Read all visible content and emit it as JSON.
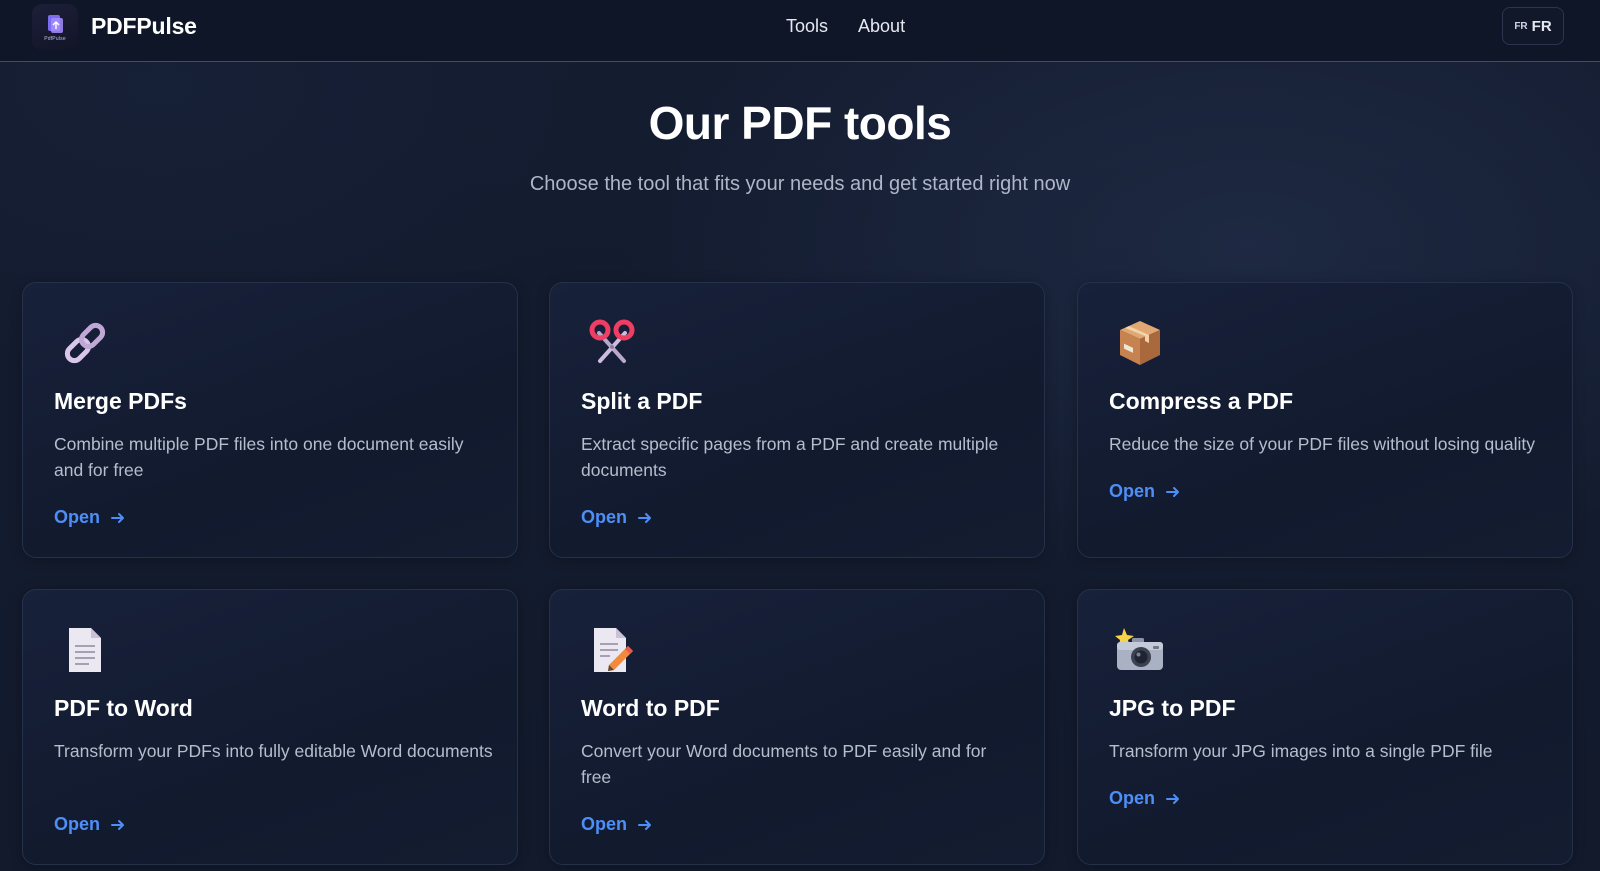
{
  "navbar": {
    "logo_text": "PdfPulse",
    "brand": "PDFPulse",
    "links": [
      "Tools",
      "About"
    ],
    "language": {
      "flag_label": "FR",
      "code": "FR"
    }
  },
  "hero": {
    "title": "Our PDF tools",
    "subtitle": "Choose the tool that fits your needs and get started right now"
  },
  "tools": [
    {
      "title": "Merge PDFs",
      "description": "Combine multiple PDF files into one document easily and for free",
      "action": "Open",
      "icon": "link-icon"
    },
    {
      "title": "Split a PDF",
      "description": "Extract specific pages from a PDF and create multiple documents",
      "action": "Open",
      "icon": "scissors-icon"
    },
    {
      "title": "Compress a PDF",
      "description": "Reduce the size of your PDF files without losing quality",
      "action": "Open",
      "icon": "package-icon"
    },
    {
      "title": "PDF to Word",
      "description": "Transform your PDFs into fully editable Word documents",
      "action": "Open",
      "icon": "document-icon"
    },
    {
      "title": "Word to PDF",
      "description": "Convert your Word documents to PDF easily and for free",
      "action": "Open",
      "icon": "document-edit-icon"
    },
    {
      "title": "JPG to PDF",
      "description": "Transform your JPG images into a single PDF file",
      "action": "Open",
      "icon": "camera-flash-icon"
    }
  ],
  "colors": {
    "background": "#131b2e",
    "navbar": "#0f1627",
    "navbar_border": "#3a4a86",
    "card_border": "#25304a",
    "accent": "#4e8ef7",
    "muted_text": "#b6bdcc"
  }
}
